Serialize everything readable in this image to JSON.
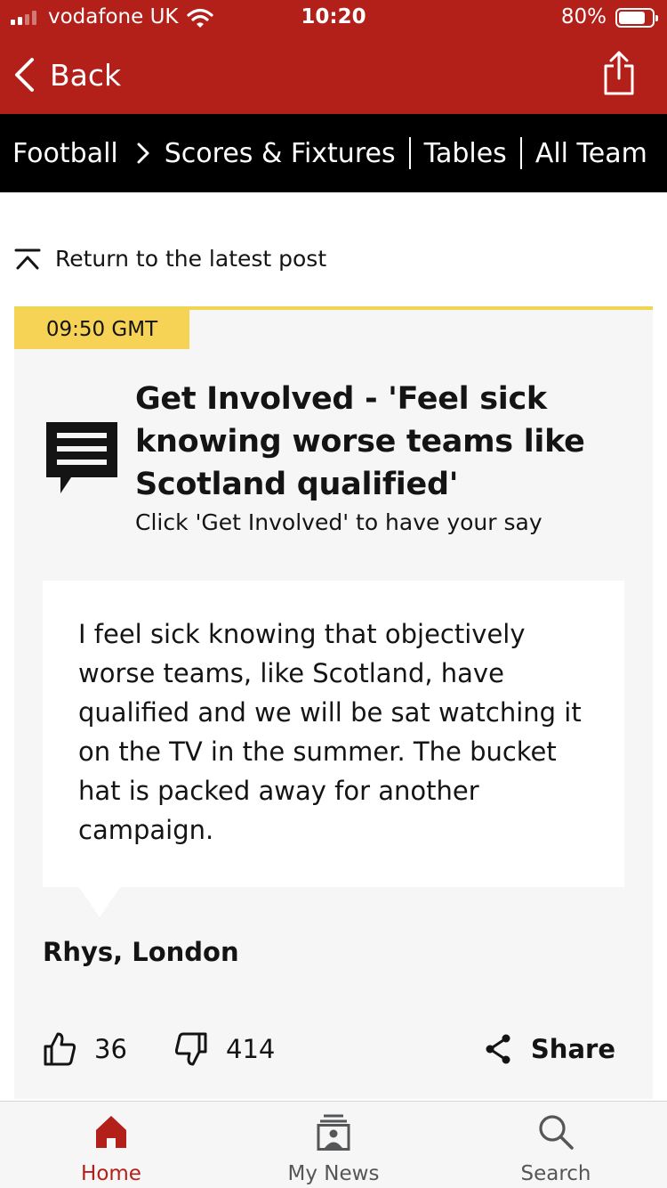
{
  "status_bar": {
    "carrier": "vodafone UK",
    "time": "10:20",
    "battery": "80%",
    "battery_level": 0.8,
    "signal_bars_filled": 2,
    "signal_bars_total": 4
  },
  "nav": {
    "back_label": "Back"
  },
  "breadcrumb": {
    "items": [
      "Football",
      "Scores & Fixtures",
      "Tables",
      "All Team"
    ]
  },
  "return_link": "Return to the latest post",
  "post": {
    "timestamp": "09:50 GMT",
    "title": "Get Involved - 'Feel sick knowing worse teams like Scotland qualified'",
    "subtitle": "Click 'Get Involved' to have your say",
    "comment": "I feel sick knowing that objectively worse teams, like Scotland, have qualified and we will be sat watching it on the TV in the summer. The bucket hat is packed away for another campaign.",
    "author": "Rhys, London",
    "likes": "36",
    "dislikes": "414",
    "share_label": "Share"
  },
  "tabs": [
    {
      "label": "Home",
      "icon": "home-icon",
      "active": true
    },
    {
      "label": "My News",
      "icon": "my-news-icon",
      "active": false
    },
    {
      "label": "Search",
      "icon": "search-icon",
      "active": false
    }
  ],
  "colors": {
    "brand_red": "#b3201a",
    "timestamp_yellow": "#f6d355",
    "nav_black": "#000000",
    "card_bg": "#f6f6f6"
  }
}
